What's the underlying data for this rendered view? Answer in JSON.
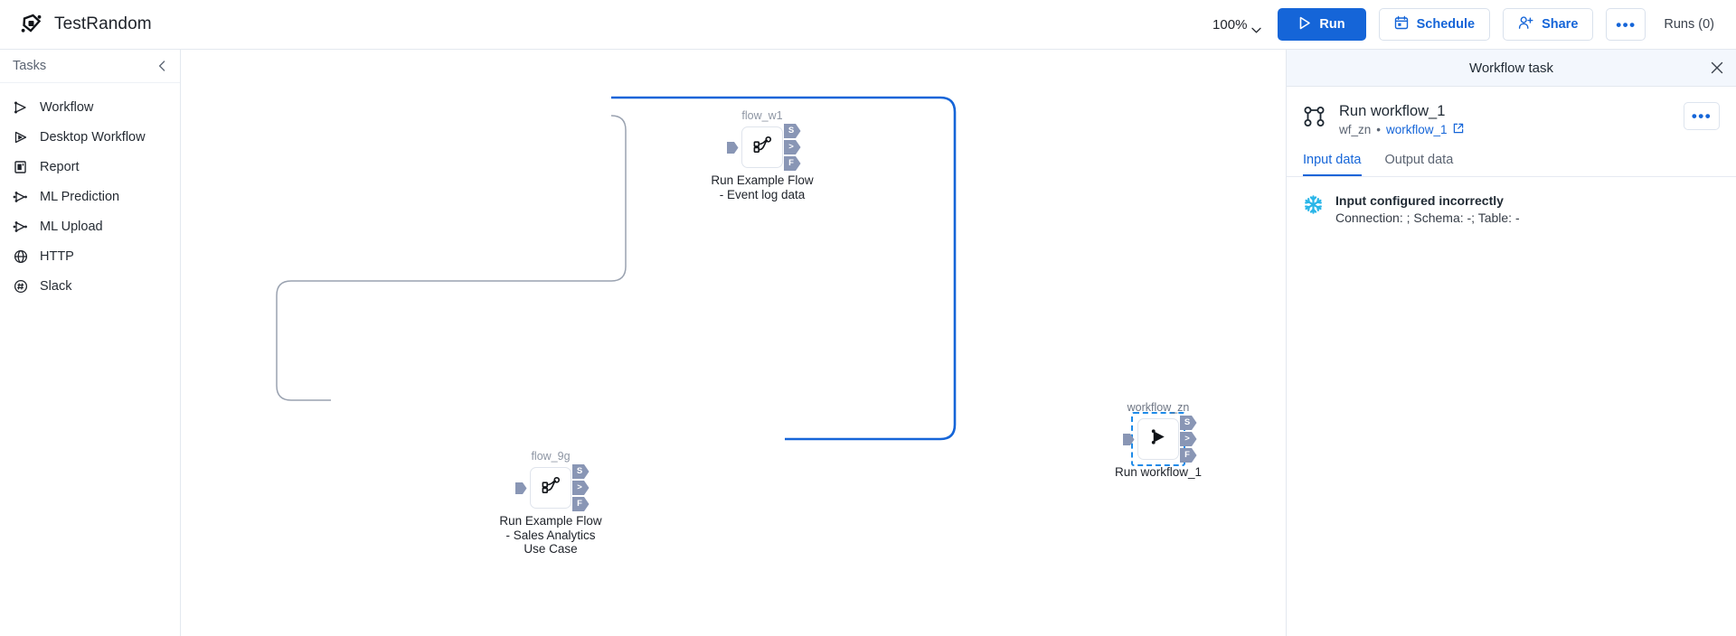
{
  "app": {
    "title": "TestRandom",
    "logo_icon": "app-logo-icon"
  },
  "toolbar": {
    "zoom_level": "100%",
    "zoom_chevron_icon": "chevron-down-icon",
    "run_label": "Run",
    "run_icon": "play-icon",
    "schedule_label": "Schedule",
    "schedule_icon": "calendar-icon",
    "share_label": "Share",
    "share_icon": "person-add-icon",
    "more_label": "•••",
    "more_icon": "ellipsis-icon",
    "runs_label": "Runs (0)"
  },
  "sidebar": {
    "header": "Tasks",
    "collapse_icon": "chevron-left-icon",
    "items": [
      {
        "label": "Workflow",
        "icon": "workflow-icon"
      },
      {
        "label": "Desktop Workflow",
        "icon": "desktop-workflow-icon"
      },
      {
        "label": "Report",
        "icon": "report-icon"
      },
      {
        "label": "ML Prediction",
        "icon": "ml-prediction-icon"
      },
      {
        "label": "ML Upload",
        "icon": "ml-upload-icon"
      },
      {
        "label": "HTTP",
        "icon": "globe-icon"
      },
      {
        "label": "Slack",
        "icon": "slack-icon"
      }
    ]
  },
  "canvas": {
    "nodes": [
      {
        "id": "flow_w1",
        "label": "Run Example Flow - Event log data",
        "icon": "flow-branch-icon",
        "selected": false,
        "ports": [
          "S",
          ">",
          "F"
        ]
      },
      {
        "id": "flow_9g",
        "label": "Run Example Flow - Sales Analytics Use Case",
        "icon": "flow-branch-icon",
        "selected": false,
        "ports": [
          "S",
          ">",
          "F"
        ]
      },
      {
        "id": "workflow_zn",
        "label": "Run workflow_1",
        "icon": "run-workflow-icon",
        "selected": true,
        "ports": [
          "S",
          ">",
          "F"
        ]
      }
    ],
    "edge_colors": {
      "active": "#1565d8",
      "inactive": "#8d95a3"
    }
  },
  "panel": {
    "title": "Workflow task",
    "close_icon": "close-icon",
    "task_icon": "workflow-node-icon",
    "task_name": "Run workflow_1",
    "task_meta_id": "wf_zn",
    "task_meta_separator": "•",
    "task_meta_link": "workflow_1",
    "external_link_icon": "external-link-icon",
    "menu_icon": "ellipsis-icon",
    "tabs": [
      {
        "label": "Input data",
        "active": true
      },
      {
        "label": "Output data",
        "active": false
      }
    ],
    "message": {
      "icon": "snowflake-icon",
      "title": "Input configured incorrectly",
      "detail": "Connection: ; Schema: -; Table: -"
    }
  },
  "colors": {
    "accent": "#1565d8",
    "panel_header_bg": "#f3f7fd",
    "port": "#8996b5",
    "snowflake": "#29b5e8"
  }
}
